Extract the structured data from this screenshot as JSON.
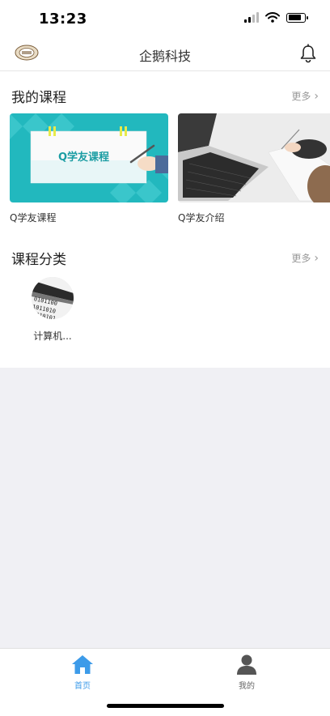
{
  "status_bar": {
    "time": "13:23",
    "wifi_icon": "wifi-icon",
    "battery_icon": "battery-icon",
    "signal_icon": "cellular-signal-icon"
  },
  "nav": {
    "title": "企鹅科技",
    "logo_icon": "brand-logo",
    "bell_icon": "bell-icon"
  },
  "my_courses": {
    "title": "我的课程",
    "more_label": "更多",
    "items": [
      {
        "name": "Q学友课程",
        "thumb_text": "Q学友课程"
      },
      {
        "name": "Q学友介绍"
      }
    ]
  },
  "categories": {
    "title": "课程分类",
    "more_label": "更多",
    "items": [
      {
        "name": "计算机..."
      }
    ]
  },
  "tab_bar": {
    "items": [
      {
        "label": "首页",
        "icon": "home-icon",
        "active": true
      },
      {
        "label": "我的",
        "icon": "person-icon",
        "active": false
      }
    ]
  },
  "colors": {
    "accent": "#3d9be9",
    "inactive": "#666666",
    "teal": "#22b8be"
  }
}
